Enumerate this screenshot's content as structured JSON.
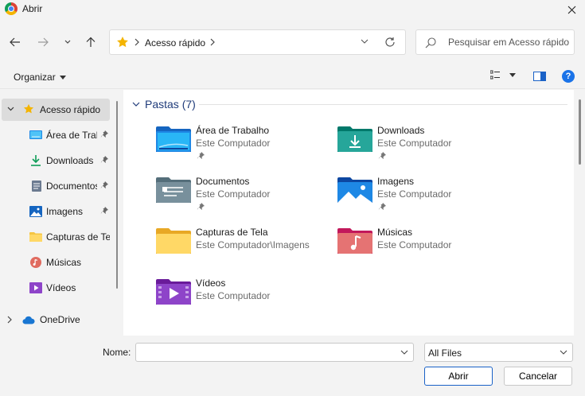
{
  "window": {
    "title": "Abrir"
  },
  "address": {
    "root": "Acesso rápido"
  },
  "search": {
    "placeholder": "Pesquisar em Acesso rápido"
  },
  "toolbar": {
    "organize_label": "Organizar"
  },
  "sidebar": {
    "items": [
      {
        "label": "Acesso rápido",
        "icon": "star-icon"
      },
      {
        "label": "Área de Trabalho",
        "icon": "desktop-icon"
      },
      {
        "label": "Downloads",
        "icon": "download-icon"
      },
      {
        "label": "Documentos",
        "icon": "document-icon"
      },
      {
        "label": "Imagens",
        "icon": "image-icon"
      },
      {
        "label": "Capturas de Tela",
        "icon": "folder-icon"
      },
      {
        "label": "Músicas",
        "icon": "music-icon"
      },
      {
        "label": "Vídeos",
        "icon": "video-icon"
      },
      {
        "label": "OneDrive",
        "icon": "cloud-icon"
      }
    ]
  },
  "content": {
    "group_label": "Pastas (7)",
    "folders": [
      {
        "name": "Área de Trabalho",
        "location": "Este Computador"
      },
      {
        "name": "Downloads",
        "location": "Este Computador"
      },
      {
        "name": "Documentos",
        "location": "Este Computador"
      },
      {
        "name": "Imagens",
        "location": "Este Computador"
      },
      {
        "name": "Capturas de Tela",
        "location": "Este Computador\\Imagens"
      },
      {
        "name": "Músicas",
        "location": "Este Computador"
      },
      {
        "name": "Vídeos",
        "location": "Este Computador"
      }
    ]
  },
  "footer": {
    "name_label": "Nome:",
    "name_value": "",
    "filter_value": "All Files",
    "open_label": "Abrir",
    "cancel_label": "Cancelar"
  },
  "colors": {
    "accent": "#1a62c7",
    "folder_yellow": "#f5c542",
    "help_blue": "#1a73e8"
  }
}
